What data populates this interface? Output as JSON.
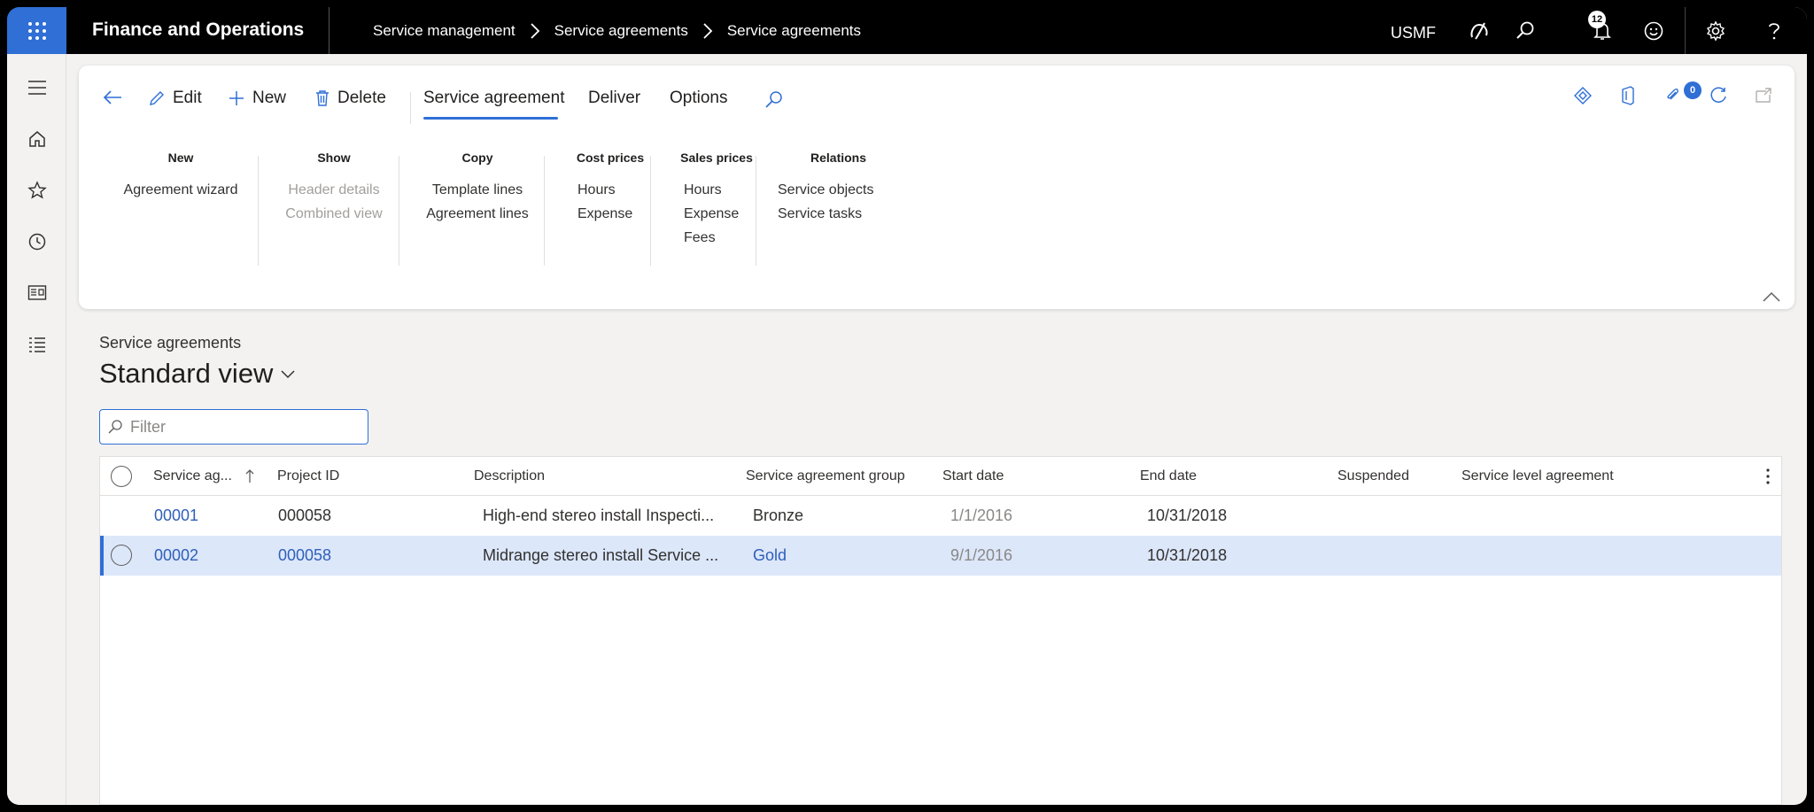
{
  "topbar": {
    "app_title": "Finance and Operations",
    "breadcrumbs": [
      "Service management",
      "Service agreements",
      "Service agreements"
    ],
    "company": "USMF",
    "notification_count": "12",
    "icons": [
      "app-launcher-icon",
      "copilot-icon",
      "search-icon",
      "bell-icon",
      "feedback-smile-icon",
      "gear-icon",
      "help-icon"
    ]
  },
  "rail": {
    "icons": [
      "hamburger-icon",
      "home-icon",
      "star-icon",
      "clock-icon",
      "workspace-icon",
      "modules-list-icon"
    ]
  },
  "action_pane": {
    "edit": "Edit",
    "new": "New",
    "delete": "Delete",
    "tabs": [
      "Service agreement",
      "Deliver",
      "Options"
    ],
    "active_tab": "Service agreement",
    "attachment_count": "0",
    "groups": [
      {
        "title": "New",
        "items": [
          {
            "label": "Agreement wizard",
            "enabled": true
          }
        ]
      },
      {
        "title": "Show",
        "items": [
          {
            "label": "Header details",
            "enabled": false
          },
          {
            "label": "Combined view",
            "enabled": false
          }
        ]
      },
      {
        "title": "Copy",
        "items": [
          {
            "label": "Template lines",
            "enabled": true
          },
          {
            "label": "Agreement lines",
            "enabled": true
          }
        ]
      },
      {
        "title": "Cost prices",
        "items": [
          {
            "label": "Hours",
            "enabled": true
          },
          {
            "label": "Expense",
            "enabled": true
          }
        ]
      },
      {
        "title": "Sales prices",
        "items": [
          {
            "label": "Hours",
            "enabled": true
          },
          {
            "label": "Expense",
            "enabled": true
          },
          {
            "label": "Fees",
            "enabled": true
          }
        ]
      },
      {
        "title": "Relations",
        "items": [
          {
            "label": "Service objects",
            "enabled": true
          },
          {
            "label": "Service tasks",
            "enabled": true
          }
        ]
      }
    ]
  },
  "page": {
    "caption": "Service agreements",
    "view_name": "Standard view",
    "filter_placeholder": "Filter"
  },
  "grid": {
    "columns": [
      "Service ag...",
      "Project ID",
      "Description",
      "Service agreement group",
      "Start date",
      "End date",
      "Suspended",
      "Service level agreement"
    ],
    "sort_column": "Service ag...",
    "rows": [
      {
        "service_agreement": "00001",
        "project_id": "000058",
        "description": "High-end stereo install Inspecti...",
        "group": "Bronze",
        "start_date": "1/1/2016",
        "end_date": "10/31/2018",
        "suspended": "",
        "sla": "",
        "selected": false
      },
      {
        "service_agreement": "00002",
        "project_id": "000058",
        "description": "Midrange stereo install Service ...",
        "group": "Gold",
        "start_date": "9/1/2016",
        "end_date": "10/31/2018",
        "suspended": "",
        "sla": "",
        "selected": true
      }
    ]
  },
  "colors": {
    "accent": "#2f6fd6",
    "link": "#2f5fb8",
    "selected_row": "#dce7fa",
    "topbar": "#000000"
  }
}
